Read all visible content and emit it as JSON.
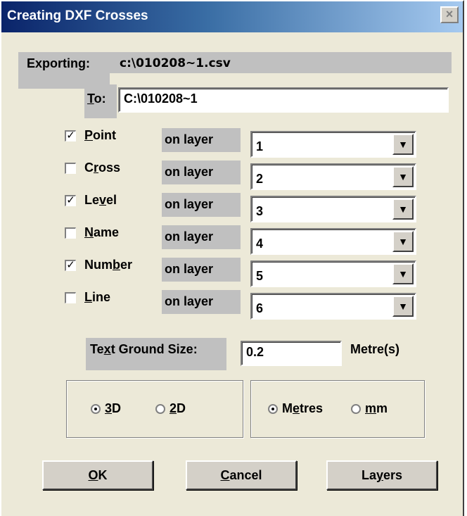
{
  "window": {
    "title": "Creating DXF Crosses",
    "close_glyph": "×"
  },
  "exporting": {
    "label": "Exporting:",
    "value": "c:\\010208~1.csv"
  },
  "to": {
    "label_u": "T",
    "label_rest": "o:",
    "value": "C:\\010208~1"
  },
  "layers": [
    {
      "pre": "",
      "u": "P",
      "post": "oint",
      "checked": true,
      "on_layer": "on layer",
      "value": "1"
    },
    {
      "pre": "C",
      "u": "r",
      "post": "oss",
      "checked": false,
      "on_layer": "on layer",
      "value": "2"
    },
    {
      "pre": "Le",
      "u": "v",
      "post": "el",
      "checked": true,
      "on_layer": "on layer",
      "value": "3"
    },
    {
      "pre": "",
      "u": "N",
      "post": "ame",
      "checked": false,
      "on_layer": "on layer",
      "value": "4"
    },
    {
      "pre": "Num",
      "u": "b",
      "post": "er",
      "checked": true,
      "on_layer": "on layer",
      "value": "5"
    },
    {
      "pre": "",
      "u": "L",
      "post": "ine",
      "checked": false,
      "on_layer": "on layer",
      "value": "6"
    }
  ],
  "text_size": {
    "label_pre": "Te",
    "label_u": "x",
    "label_post": "t Ground Size:",
    "value": "0.2",
    "unit": "Metre(s)"
  },
  "dimension": {
    "opt3d_u": "3",
    "opt3d_rest": "D",
    "opt2d_u": "2",
    "opt2d_rest": "D",
    "selected": "3D"
  },
  "units": {
    "metres_pre": "M",
    "metres_u": "e",
    "metres_post": "tres",
    "mm_u": "m",
    "mm_rest": "m",
    "selected": "Metres"
  },
  "buttons": {
    "ok_u": "O",
    "ok_rest": "K",
    "cancel_u": "C",
    "cancel_rest": "ancel",
    "layers_pre": "La",
    "layers_u": "y",
    "layers_post": "ers"
  },
  "check_glyph": "✓",
  "arrow_glyph": "▼"
}
